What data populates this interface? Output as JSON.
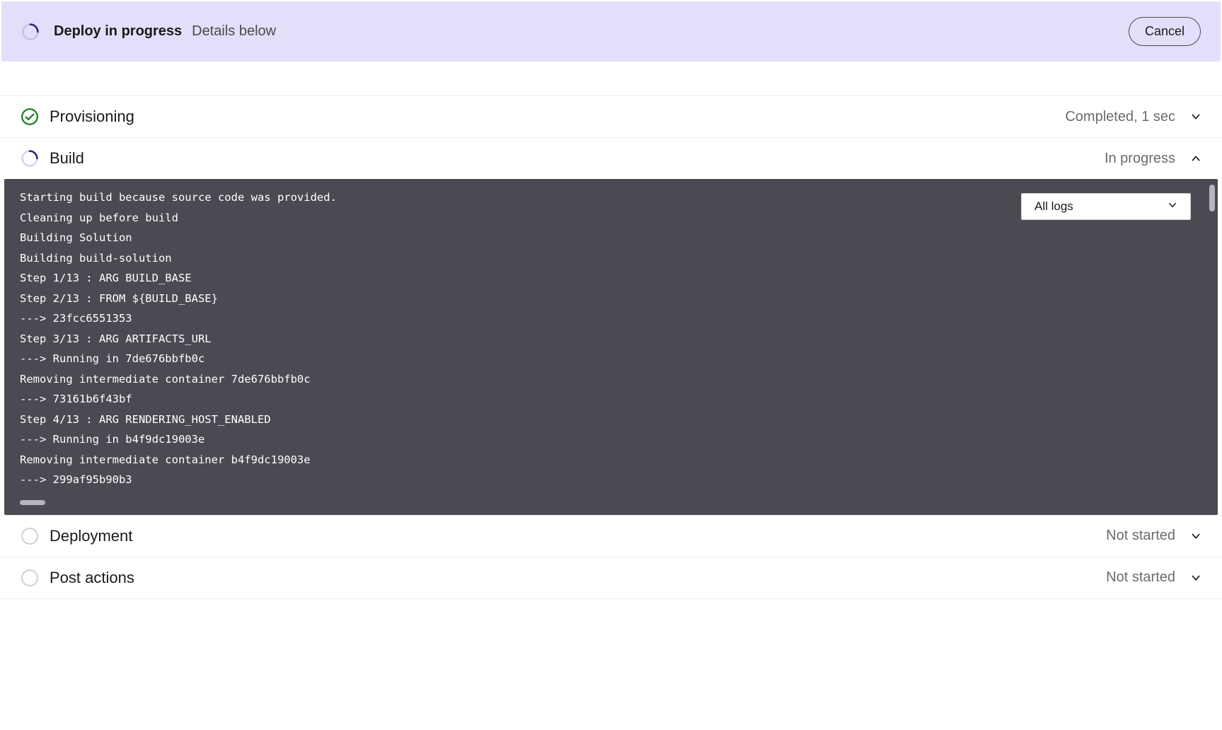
{
  "banner": {
    "title": "Deploy in progress",
    "subtitle": "Details below",
    "cancel_label": "Cancel"
  },
  "log_filter": {
    "selected": "All logs"
  },
  "stages": [
    {
      "name": "Provisioning",
      "status": "Completed, 1 sec",
      "state": "completed",
      "expanded": false
    },
    {
      "name": "Build",
      "status": "In progress",
      "state": "inprogress",
      "expanded": true
    },
    {
      "name": "Deployment",
      "status": "Not started",
      "state": "idle",
      "expanded": false
    },
    {
      "name": "Post actions",
      "status": "Not started",
      "state": "idle",
      "expanded": false
    }
  ],
  "build_logs": [
    "Starting build because source code was provided.",
    "Cleaning up before build",
    "Building Solution",
    "Building build-solution",
    "Step 1/13 : ARG BUILD_BASE",
    "Step 2/13 : FROM ${BUILD_BASE}",
    "---> 23fcc6551353",
    "Step 3/13 : ARG ARTIFACTS_URL",
    "---> Running in 7de676bbfb0c",
    "Removing intermediate container 7de676bbfb0c",
    "---> 73161b6f43bf",
    "Step 4/13 : ARG RENDERING_HOST_ENABLED",
    "---> Running in b4f9dc19003e",
    "Removing intermediate container b4f9dc19003e",
    "---> 299af95b90b3"
  ]
}
